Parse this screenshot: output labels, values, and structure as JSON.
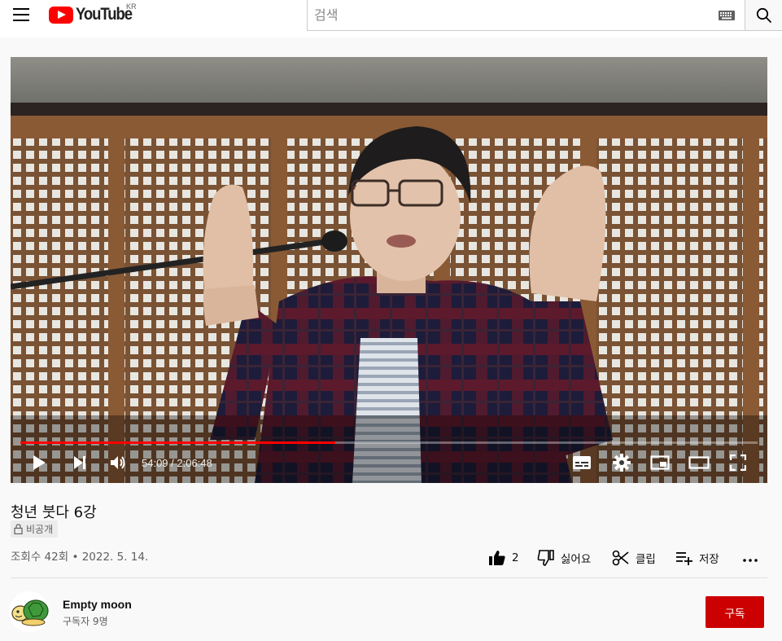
{
  "header": {
    "logo_text": "YouTube",
    "country_code": "KR",
    "search_placeholder": "검색",
    "icons": [
      "menu-icon",
      "youtube-logo",
      "keyboard-icon",
      "search-icon"
    ]
  },
  "player": {
    "time_display": "54:09 / 2:06:48",
    "progress_fraction": 0.4268,
    "progress_color": "#ff0000",
    "icons": [
      "play-icon",
      "next-icon",
      "volume-icon",
      "subtitles-icon",
      "settings-icon",
      "miniplayer-icon",
      "theater-icon",
      "fullscreen-icon"
    ]
  },
  "video": {
    "title": "청년 붓다 6강",
    "privacy_label": "비공개",
    "view_info": "조회수 42회 • 2022. 5. 14.",
    "like_count": "2",
    "dislike_label": "싫어요",
    "clip_label": "클립",
    "save_label": "저장"
  },
  "channel": {
    "name": "Empty moon",
    "subscribers": "구독자 9명",
    "subscribe_label": "구독",
    "subscribe_color": "#cc0000"
  }
}
